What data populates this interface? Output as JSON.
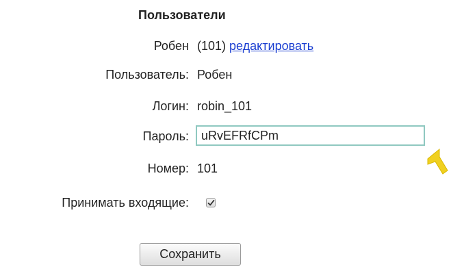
{
  "header": {
    "title": "Пользователи"
  },
  "user_summary": {
    "name": "Робен",
    "id_text": "(101)",
    "edit_link": "редактировать"
  },
  "form": {
    "user_label": "Пользователь:",
    "user_value": "Робен",
    "login_label": "Логин:",
    "login_value": "robin_101",
    "password_label": "Пароль:",
    "password_value": "uRvEFRfCPm",
    "number_label": "Номер:",
    "number_value": "101",
    "incoming_label": "Принимать входящие:",
    "incoming_checked": true,
    "save_label": "Сохранить"
  },
  "colors": {
    "link": "#1a3ed1",
    "input_border": "#8fc8c0",
    "cursor": "#f0d020"
  },
  "icons": {
    "cursor": "arrow-cursor-icon",
    "checkmark": "check-icon"
  }
}
